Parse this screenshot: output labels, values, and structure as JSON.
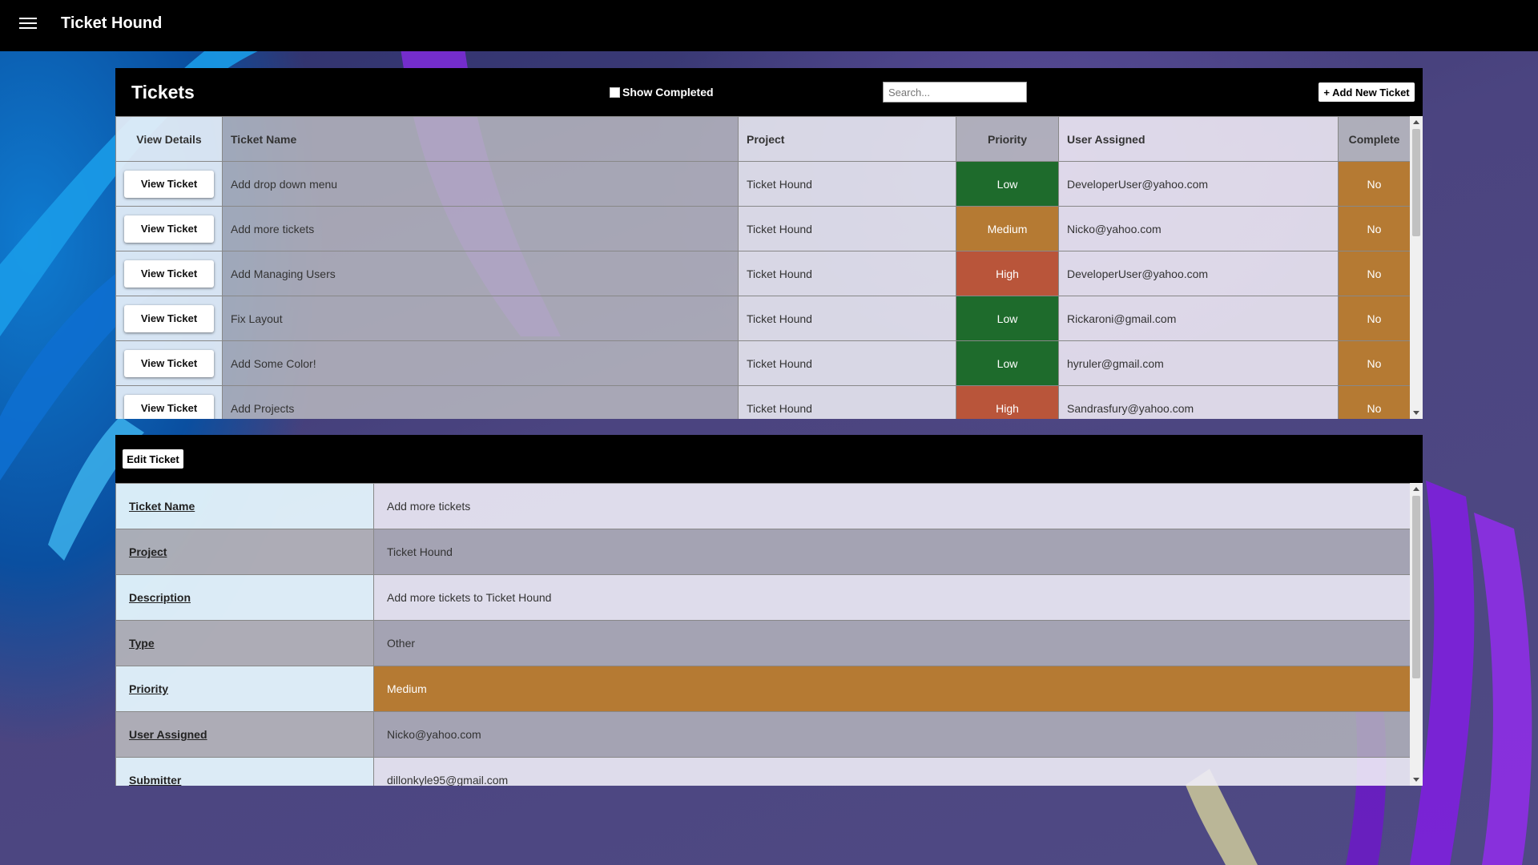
{
  "app": {
    "title": "Ticket Hound"
  },
  "tickets_panel": {
    "title": "Tickets",
    "show_completed_label": "Show Completed",
    "search_placeholder": "Search...",
    "add_button": "+ Add New Ticket",
    "headers": [
      "View Details",
      "Ticket Name",
      "Project",
      "Priority",
      "User Assigned",
      "Complete"
    ],
    "view_button_label": "View Ticket",
    "rows": [
      {
        "name": "Add drop down menu",
        "project": "Ticket Hound",
        "priority": "Low",
        "user": "DeveloperUser@yahoo.com",
        "complete": "No"
      },
      {
        "name": "Add more tickets",
        "project": "Ticket Hound",
        "priority": "Medium",
        "user": "Nicko@yahoo.com",
        "complete": "No"
      },
      {
        "name": "Add Managing Users",
        "project": "Ticket Hound",
        "priority": "High",
        "user": "DeveloperUser@yahoo.com",
        "complete": "No"
      },
      {
        "name": "Fix Layout",
        "project": "Ticket Hound",
        "priority": "Low",
        "user": "Rickaroni@gmail.com",
        "complete": "No"
      },
      {
        "name": "Add Some Color!",
        "project": "Ticket Hound",
        "priority": "Low",
        "user": "hyruler@gmail.com",
        "complete": "No"
      },
      {
        "name": "Add Projects",
        "project": "Ticket Hound",
        "priority": "High",
        "user": "Sandrasfury@yahoo.com",
        "complete": "No"
      }
    ]
  },
  "detail_panel": {
    "edit_button": "Edit Ticket",
    "fields": [
      {
        "label": "Ticket Name",
        "value": "Add more tickets"
      },
      {
        "label": "Project",
        "value": "Ticket Hound"
      },
      {
        "label": "Description",
        "value": "Add more tickets to Ticket Hound"
      },
      {
        "label": "Type",
        "value": "Other"
      },
      {
        "label": "Priority",
        "value": "Medium"
      },
      {
        "label": "User Assigned",
        "value": "Nicko@yahoo.com"
      },
      {
        "label": "Submitter",
        "value": "dillonkyle95@gmail.com"
      }
    ]
  },
  "colors": {
    "priority_low": "#1e6b2c",
    "priority_medium": "#b57a33",
    "priority_high": "#b9553a",
    "complete_no": "#b57a33"
  }
}
